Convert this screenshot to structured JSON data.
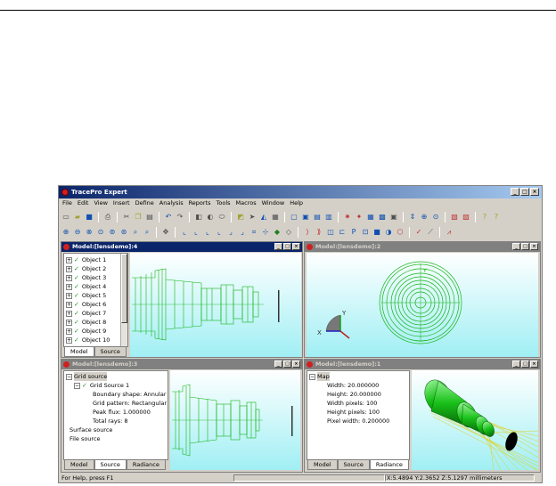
{
  "app": {
    "title": "TracePro Expert"
  },
  "menu": [
    "File",
    "Edit",
    "View",
    "Insert",
    "Define",
    "Analysis",
    "Reports",
    "Tools",
    "Macros",
    "Window",
    "Help"
  ],
  "pane_model4": {
    "title": "Model:[lensdemo]:4",
    "tree": [
      "Object 1",
      "Object 2",
      "Object 3",
      "Object 4",
      "Object 5",
      "Object 6",
      "Object 7",
      "Object 8",
      "Object 9",
      "Object 10"
    ],
    "tabs": [
      "Model",
      "Source"
    ],
    "active_tab": "Model"
  },
  "pane_model2": {
    "title": "Model:[lensdemo]:2",
    "axis_x": "X",
    "axis_y": "Y"
  },
  "pane_model3": {
    "title": "Model:[lensdemo]:3",
    "tree": {
      "root": "Grid source",
      "child": "Grid Source 1",
      "props": [
        "Boundary shape: Annular",
        "Grid pattern: Rectangular",
        "Peak flux: 1.000000",
        "Total rays: 8"
      ],
      "others": [
        "Surface source",
        "File source"
      ]
    },
    "tabs": [
      "Model",
      "Source",
      "Radiance"
    ],
    "active_tab": "Source"
  },
  "pane_model1": {
    "title": "Model:[lensdemo]:1",
    "tree": {
      "root": "Map",
      "props": [
        "Width: 20.000000",
        "Height: 20.000000",
        "Width pixels: 100",
        "Height pixels: 100",
        "Pixel width: 0.200000"
      ]
    },
    "tabs": [
      "Model",
      "Source",
      "Radiance"
    ],
    "active_tab": "Radiance"
  },
  "status": {
    "help": "For Help, press F1",
    "coords": "X:5.4894 Y:2.3652 Z:5.1297 millimeters"
  },
  "colors": {
    "accent": "#0a246a",
    "viewport_top": "#ffffff",
    "viewport_bottom": "#9ef0f4",
    "wireframe": "#14b414",
    "ray": "#e0d020"
  }
}
